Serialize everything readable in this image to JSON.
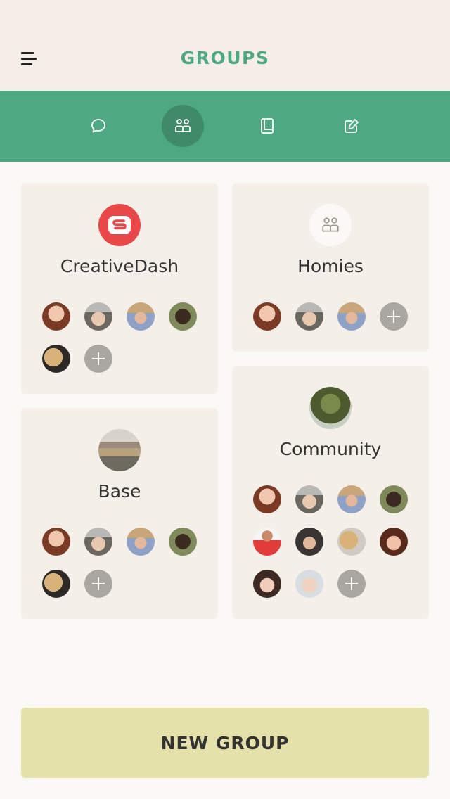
{
  "header": {
    "title": "GROUPS"
  },
  "tabs": [
    {
      "name": "chat",
      "icon": "chat-bubble-icon"
    },
    {
      "name": "groups",
      "icon": "groups-icon",
      "active": true
    },
    {
      "name": "book",
      "icon": "book-icon"
    },
    {
      "name": "edit",
      "icon": "edit-icon"
    }
  ],
  "groups": [
    {
      "name": "CreativeDash",
      "icon": "creativedash-logo",
      "members": 5
    },
    {
      "name": "Homies",
      "icon": "groups-icon",
      "members": 3
    },
    {
      "name": "Base",
      "icon": "landscape-photo",
      "members": 5
    },
    {
      "name": "Community",
      "icon": "plant-photo",
      "members": 10
    }
  ],
  "new_group_label": "NEW GROUP",
  "colors": {
    "accent": "#4ea983",
    "accent_dark": "#3f8a69",
    "card_bg": "#f4efe9",
    "header_bg": "#f6efe9",
    "button_bg": "#e4e1ab",
    "logo_red": "#e94849",
    "add_grey": "#aaa7a2"
  }
}
